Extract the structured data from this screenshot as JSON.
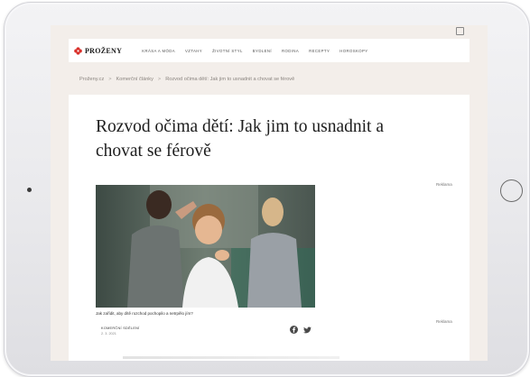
{
  "site": {
    "logo_text": "PROŽENY",
    "nav": [
      "KRÁSA A MÓDA",
      "VZTAHY",
      "ŽIVOTNÍ STYL",
      "BYDLENÍ",
      "RODINA",
      "RECEPTY",
      "HOROSKOPY"
    ]
  },
  "breadcrumb": {
    "items": [
      "Proženy.cz",
      "Komerční články",
      "Rozvod očima dětí: Jak jim to usnadnit a chovat se férově"
    ],
    "separator": ">"
  },
  "article": {
    "title": "Rozvod očima dětí: Jak jim to usnadnit a chovat se férově",
    "image_caption": "Jak zařídit, aby dítě rozchod pochopilo a netrpělo jím?",
    "author": "KOMERČNÍ SDĚLENÍ",
    "date": "2. 3. 2021"
  },
  "ads": {
    "label_1": "Reklama",
    "label_2": "Reklama"
  },
  "icons": {
    "logo": "flower-logo-icon",
    "share_facebook": "facebook-icon",
    "share_twitter": "twitter-icon",
    "tabs": "tabs-icon"
  },
  "colors": {
    "brand_red": "#d9312b",
    "page_bg": "#f3eeea",
    "content_bg": "#ffffff",
    "title_text": "#1d1d1d"
  }
}
